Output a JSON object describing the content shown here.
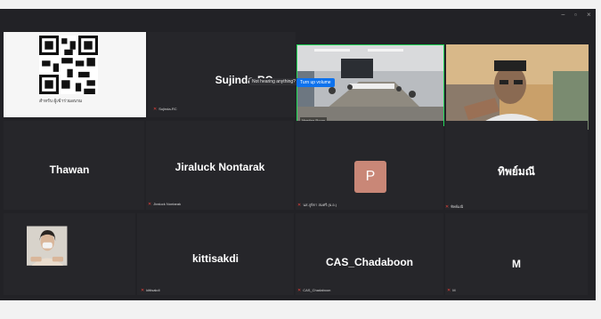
{
  "window": {
    "minimize": "−",
    "maximize": "▫",
    "close": "×"
  },
  "tooltip": "Not hearing anything?",
  "turn_up_button": "Turn up volume",
  "tiles": {
    "qr": {
      "caption": "สำหรับ ผู้เข้าร่วมอบรม"
    },
    "sujinda": {
      "name": "Sujinda-RC",
      "label": "Sujinda-RC"
    },
    "room": {
      "label": "Meeting Room"
    },
    "man": {
      "label": "Preechaa Vo Mohammed"
    },
    "thawan": {
      "name": "Thawan"
    },
    "jiraluck": {
      "name": "Jiraluck Nontarak",
      "label": "Jiraluck Nontarak"
    },
    "p": {
      "initial": "P",
      "label": "นส.ภูษิกา สมศรี (ผ.อ.)"
    },
    "thai": {
      "name": "ทิพย์มณี",
      "label": "ทิพย์มณี"
    },
    "woman": {},
    "kittisakdi": {
      "name": "kittisakdi",
      "label": "kittisakdi"
    },
    "chadaboon": {
      "name": "CAS_Chadaboon",
      "label": "CAS_Chadaboon"
    },
    "m": {
      "name": "M",
      "label": "M"
    }
  },
  "colors": {
    "active_speaker": "#23d959",
    "accent": "#0e72ed",
    "mute": "#e0403a"
  }
}
